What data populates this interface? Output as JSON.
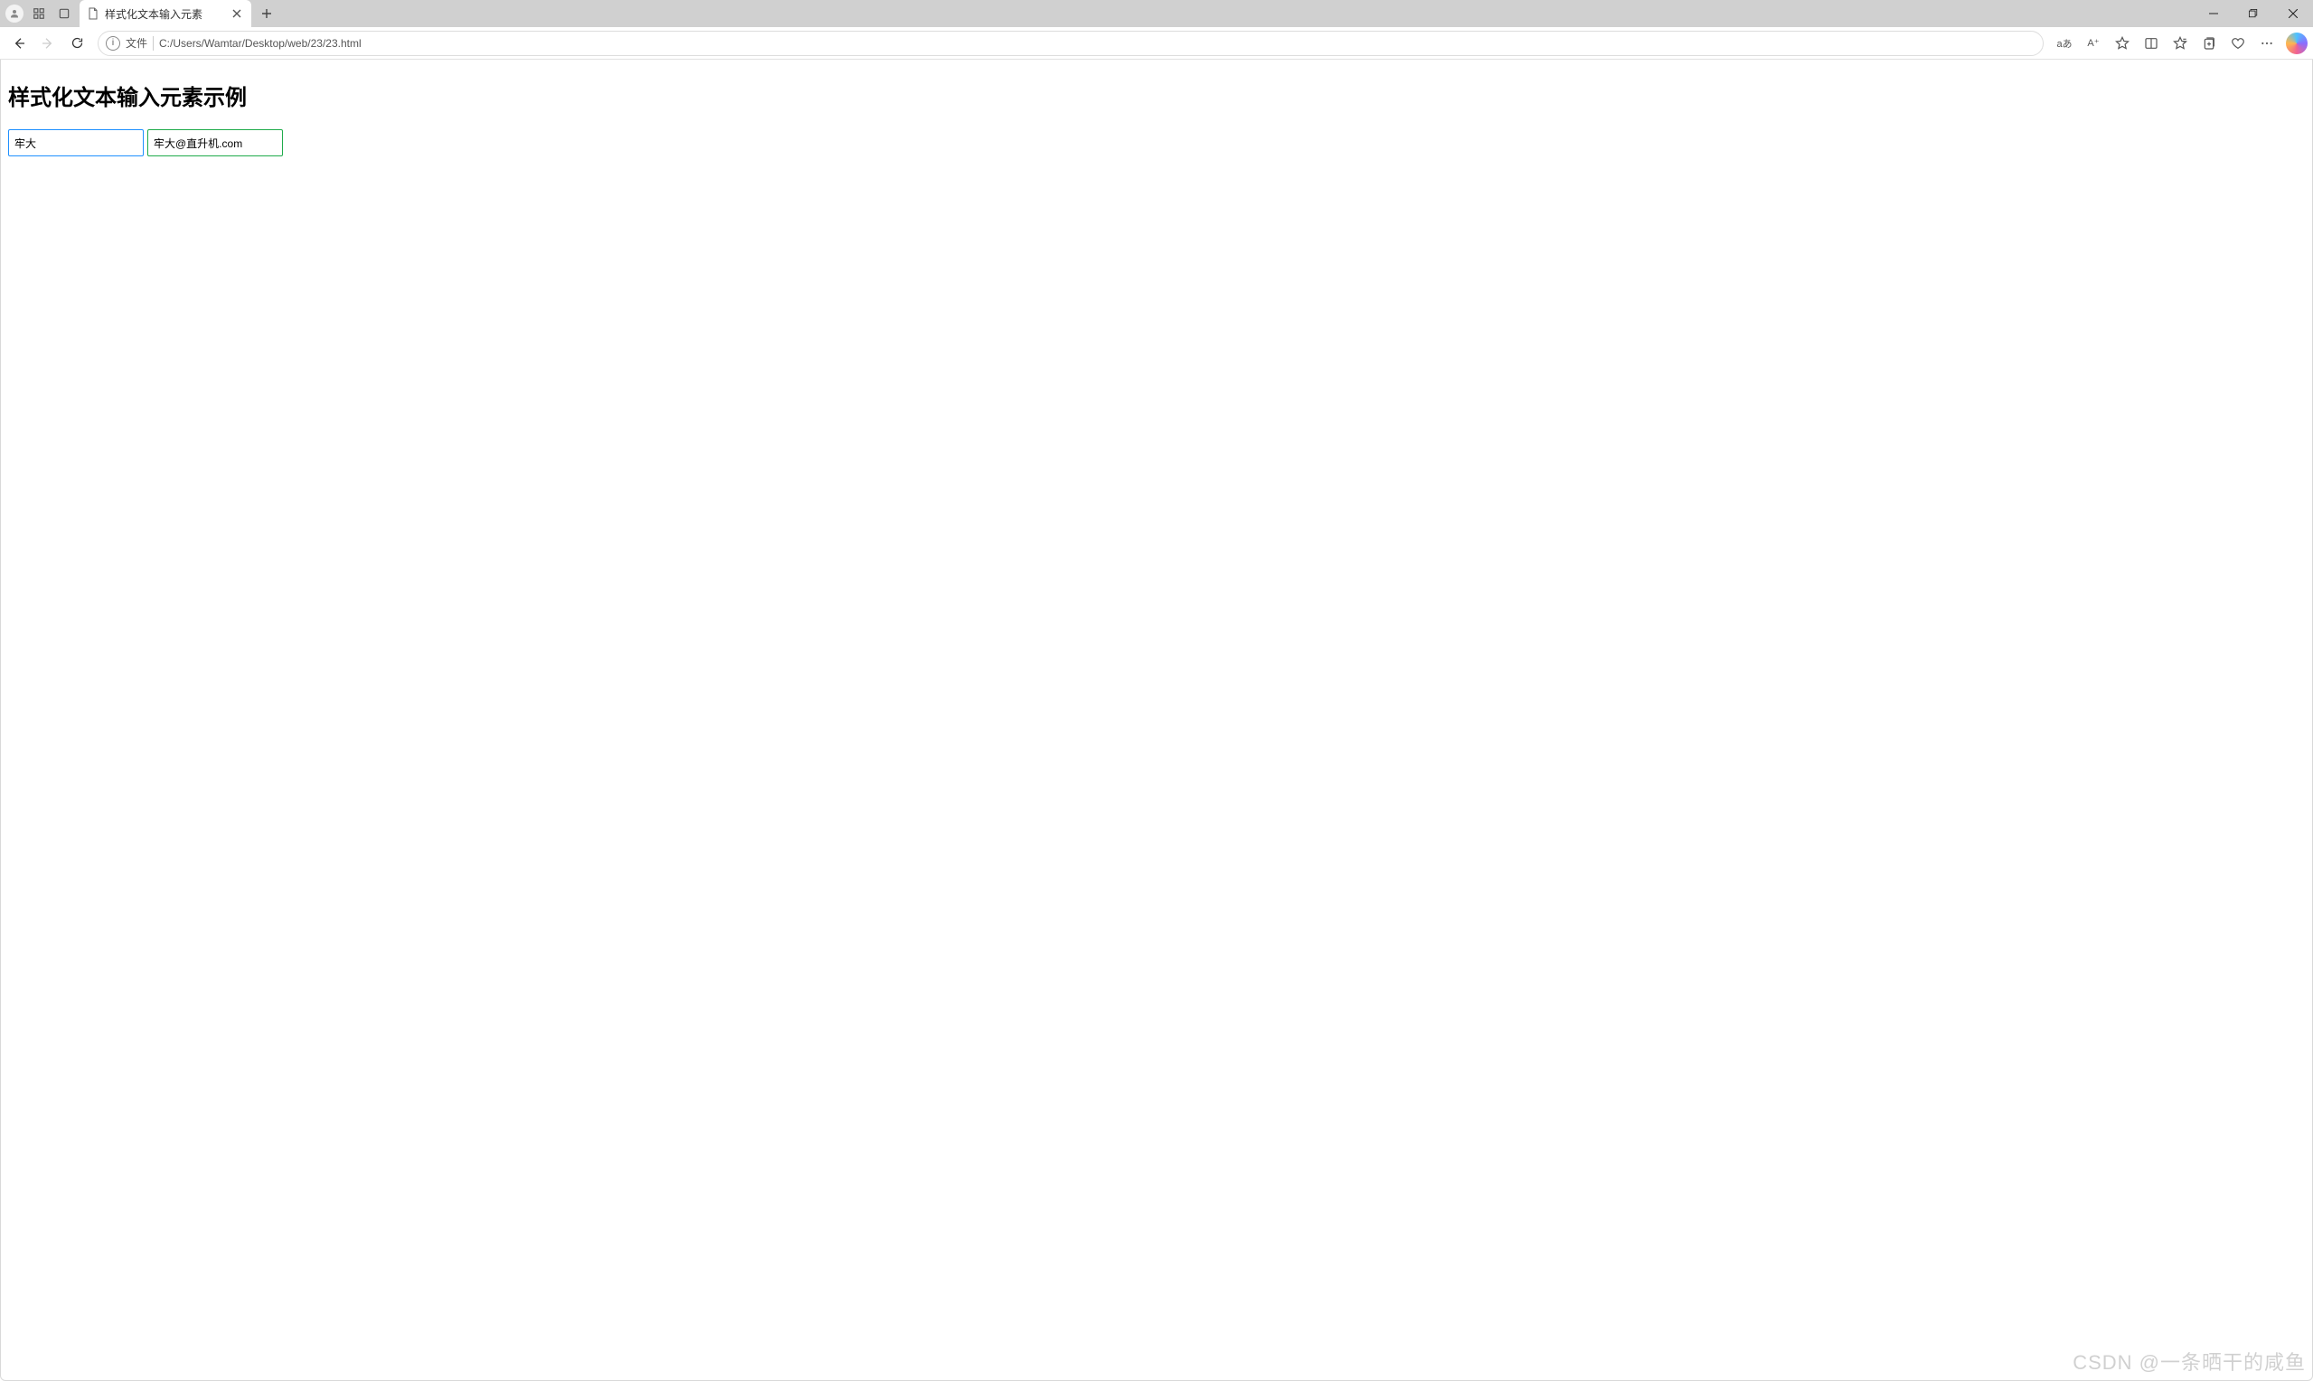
{
  "tab": {
    "title": "样式化文本输入元素"
  },
  "addressbar": {
    "scheme_label": "文件",
    "path": "C:/Users/Wamtar/Desktop/web/23/23.html"
  },
  "toolbar_right": {
    "translate_label": "aあ",
    "readaloud_label": "A⁺"
  },
  "page": {
    "heading": "样式化文本输入元素示例",
    "text_input_value": "牢大",
    "email_input_value": "牢大@直升机.com"
  },
  "watermark": "CSDN @一条晒干的咸鱼"
}
